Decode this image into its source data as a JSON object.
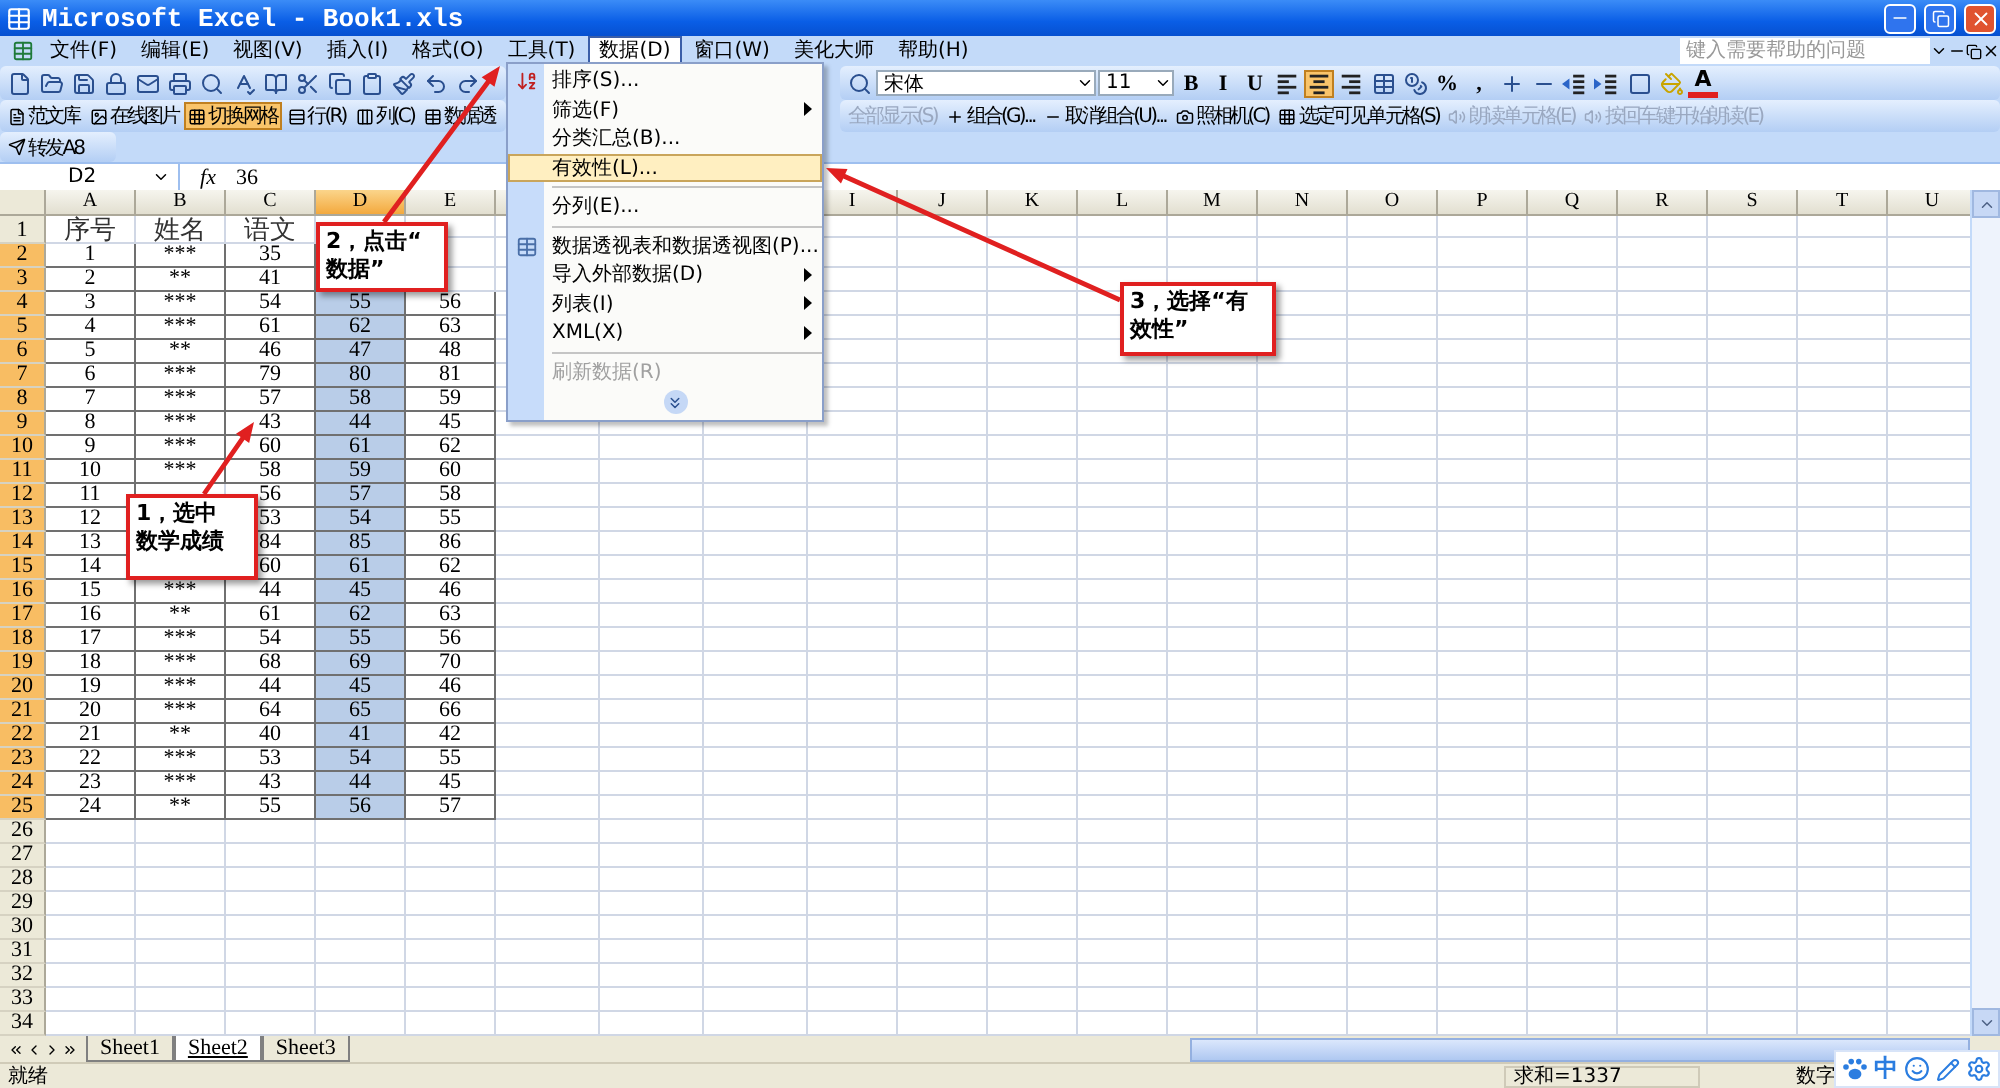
{
  "window": {
    "title": "Microsoft Excel - Book1.xls"
  },
  "menu_bar": {
    "items": [
      {
        "label": "文件(F)",
        "selected": false
      },
      {
        "label": "编辑(E)",
        "selected": false
      },
      {
        "label": "视图(V)",
        "selected": false
      },
      {
        "label": "插入(I)",
        "selected": false
      },
      {
        "label": "格式(O)",
        "selected": false
      },
      {
        "label": "工具(T)",
        "selected": false
      },
      {
        "label": "数据(D)",
        "selected": true
      },
      {
        "label": "窗口(W)",
        "selected": false
      },
      {
        "label": "美化大师",
        "selected": false
      },
      {
        "label": "帮助(H)",
        "selected": false
      }
    ],
    "help_field": {
      "placeholder": "键入需要帮助的问题"
    }
  },
  "formatting_toolbar": {
    "font": "宋体",
    "font_size": "11",
    "buttons": [
      {
        "kind": "text",
        "label": "B",
        "selected": false
      },
      {
        "kind": "text",
        "label": "I",
        "selected": false
      },
      {
        "kind": "text",
        "label": "U",
        "selected": false
      },
      {
        "kind": "align-left",
        "selected": false
      },
      {
        "kind": "align-center",
        "selected": true
      },
      {
        "kind": "align-right",
        "selected": false
      },
      {
        "kind": "merge",
        "selected": false
      },
      {
        "kind": "currency",
        "selected": false
      },
      {
        "kind": "text",
        "label": "%",
        "selected": false
      },
      {
        "kind": "text",
        "label": ",",
        "selected": false
      },
      {
        "kind": "decimal-more",
        "selected": false
      },
      {
        "kind": "decimal-less",
        "selected": false
      },
      {
        "kind": "indent-less",
        "selected": false
      },
      {
        "kind": "indent-more",
        "selected": false
      },
      {
        "kind": "borders",
        "selected": false
      },
      {
        "kind": "fill",
        "selected": false
      },
      {
        "kind": "font-color",
        "label": "A",
        "selected": false
      }
    ]
  },
  "tools_toolbar": {
    "left_items": [
      {
        "label": "范文库",
        "selected": false,
        "disabled": false
      },
      {
        "label": "在线图片",
        "selected": false,
        "disabled": false
      },
      {
        "label": "切换网格",
        "selected": true,
        "disabled": false
      },
      {
        "label": "行(R)",
        "selected": false,
        "disabled": false
      },
      {
        "label": "列(C)",
        "selected": false,
        "disabled": false
      },
      {
        "label": "数据透",
        "selected": false,
        "disabled": false
      }
    ],
    "right_items": [
      {
        "label": "全部显示(S)",
        "selected": false,
        "disabled": true
      },
      {
        "label": "组合(G)...",
        "selected": false,
        "disabled": false
      },
      {
        "label": "取消组合(U)...",
        "selected": false,
        "disabled": false
      },
      {
        "label": "照相机(C)",
        "selected": false,
        "disabled": false
      },
      {
        "label": "选定可见单元格(S)",
        "selected": false,
        "disabled": false
      },
      {
        "label": "朗读单元格(E)",
        "selected": false,
        "disabled": true
      },
      {
        "label": "按回车键开始朗读(E)",
        "selected": false,
        "disabled": true
      }
    ]
  },
  "forward_toolbar": {
    "label": "转发A8"
  },
  "formula_bar": {
    "name_box": "D2",
    "function_symbol": "fx",
    "value": "36"
  },
  "data_menu": {
    "items": [
      {
        "kind": "item",
        "label": "排序(S)...",
        "submenu": false,
        "selected": false,
        "disabled": false
      },
      {
        "kind": "item",
        "label": "筛选(F)",
        "submenu": true,
        "selected": false,
        "disabled": false
      },
      {
        "kind": "item",
        "label": "分类汇总(B)...",
        "submenu": false,
        "selected": false,
        "disabled": false
      },
      {
        "kind": "item",
        "label": "有效性(L)...",
        "submenu": false,
        "selected": true,
        "disabled": false
      },
      {
        "kind": "separator"
      },
      {
        "kind": "item",
        "label": "分列(E)...",
        "submenu": false,
        "selected": false,
        "disabled": false
      },
      {
        "kind": "separator"
      },
      {
        "kind": "item",
        "label": "数据透视表和数据透视图(P)...",
        "submenu": false,
        "selected": false,
        "disabled": false
      },
      {
        "kind": "item",
        "label": "导入外部数据(D)",
        "submenu": true,
        "selected": false,
        "disabled": false
      },
      {
        "kind": "item",
        "label": "列表(I)",
        "submenu": true,
        "selected": false,
        "disabled": false
      },
      {
        "kind": "item",
        "label": "XML(X)",
        "submenu": true,
        "selected": false,
        "disabled": false
      },
      {
        "kind": "separator"
      },
      {
        "kind": "item",
        "label": "刷新数据(R)",
        "submenu": false,
        "selected": false,
        "disabled": true
      },
      {
        "kind": "expand"
      }
    ]
  },
  "sheet": {
    "columns": [
      {
        "letter": "A",
        "selected": false
      },
      {
        "letter": "B",
        "selected": false
      },
      {
        "letter": "C",
        "selected": false
      },
      {
        "letter": "D",
        "selected": true
      },
      {
        "letter": "E",
        "selected": false
      },
      null,
      null,
      null,
      {
        "letter": "I",
        "selected": false
      },
      {
        "letter": "J",
        "selected": false
      },
      {
        "letter": "K",
        "selected": false
      },
      {
        "letter": "L",
        "selected": false
      },
      {
        "letter": "M",
        "selected": false
      },
      {
        "letter": "N",
        "selected": false
      },
      {
        "letter": "O",
        "selected": false
      },
      {
        "letter": "P",
        "selected": false
      },
      {
        "letter": "Q",
        "selected": false
      },
      {
        "letter": "R",
        "selected": false
      },
      {
        "letter": "S",
        "selected": false
      },
      {
        "letter": "T",
        "selected": false
      },
      {
        "letter": "U",
        "selected": false
      }
    ],
    "rows": [
      {
        "number": "1",
        "selected": false,
        "cells": [
          "序号",
          "姓名",
          "语文",
          null,
          null
        ]
      },
      {
        "number": "2",
        "selected": true,
        "cells": [
          "1",
          "***",
          "35",
          null,
          null
        ]
      },
      {
        "number": "3",
        "selected": true,
        "cells": [
          "2",
          "**",
          "41",
          null,
          null
        ]
      },
      {
        "number": "4",
        "selected": true,
        "cells": [
          "3",
          "***",
          "54",
          "55",
          "56"
        ]
      },
      {
        "number": "5",
        "selected": true,
        "cells": [
          "4",
          "***",
          "61",
          "62",
          "63"
        ]
      },
      {
        "number": "6",
        "selected": true,
        "cells": [
          "5",
          "**",
          "46",
          "47",
          "48"
        ]
      },
      {
        "number": "7",
        "selected": true,
        "cells": [
          "6",
          "***",
          "79",
          "80",
          "81"
        ]
      },
      {
        "number": "8",
        "selected": true,
        "cells": [
          "7",
          "***",
          "57",
          "58",
          "59"
        ]
      },
      {
        "number": "9",
        "selected": true,
        "cells": [
          "8",
          "***",
          "43",
          "44",
          "45"
        ]
      },
      {
        "number": "10",
        "selected": true,
        "cells": [
          "9",
          "***",
          "60",
          "61",
          "62"
        ]
      },
      {
        "number": "11",
        "selected": true,
        "cells": [
          "10",
          "***",
          "58",
          "59",
          "60"
        ]
      },
      {
        "number": "12",
        "selected": true,
        "cells": [
          "11",
          null,
          "56",
          "57",
          "58"
        ]
      },
      {
        "number": "13",
        "selected": true,
        "cells": [
          "12",
          null,
          "53",
          "54",
          "55"
        ]
      },
      {
        "number": "14",
        "selected": true,
        "cells": [
          "13",
          null,
          "84",
          "85",
          "86"
        ]
      },
      {
        "number": "15",
        "selected": true,
        "cells": [
          "14",
          null,
          "60",
          "61",
          "62"
        ]
      },
      {
        "number": "16",
        "selected": true,
        "cells": [
          "15",
          "***",
          "44",
          "45",
          "46"
        ]
      },
      {
        "number": "17",
        "selected": true,
        "cells": [
          "16",
          "**",
          "61",
          "62",
          "63"
        ]
      },
      {
        "number": "18",
        "selected": true,
        "cells": [
          "17",
          "***",
          "54",
          "55",
          "56"
        ]
      },
      {
        "number": "19",
        "selected": true,
        "cells": [
          "18",
          "***",
          "68",
          "69",
          "70"
        ]
      },
      {
        "number": "20",
        "selected": true,
        "cells": [
          "19",
          "***",
          "44",
          "45",
          "46"
        ]
      },
      {
        "number": "21",
        "selected": true,
        "cells": [
          "20",
          "***",
          "64",
          "65",
          "66"
        ]
      },
      {
        "number": "22",
        "selected": true,
        "cells": [
          "21",
          "**",
          "40",
          "41",
          "42"
        ]
      },
      {
        "number": "23",
        "selected": true,
        "cells": [
          "22",
          "***",
          "53",
          "54",
          "55"
        ]
      },
      {
        "number": "24",
        "selected": true,
        "cells": [
          "23",
          "***",
          "43",
          "44",
          "45"
        ]
      },
      {
        "number": "25",
        "selected": true,
        "cells": [
          "24",
          "**",
          "55",
          "56",
          "57"
        ]
      },
      {
        "number": "26",
        "selected": false
      },
      {
        "number": "27",
        "selected": false
      },
      {
        "number": "28",
        "selected": false
      },
      {
        "number": "29",
        "selected": false
      },
      {
        "number": "30",
        "selected": false
      },
      {
        "number": "31",
        "selected": false
      },
      {
        "number": "32",
        "selected": false
      },
      {
        "number": "33",
        "selected": false
      },
      {
        "number": "34",
        "selected": false
      }
    ]
  },
  "sheet_tabs": [
    {
      "label": "Sheet1",
      "selected": false
    },
    {
      "label": "Sheet2",
      "selected": true
    },
    {
      "label": "Sheet3",
      "selected": false
    }
  ],
  "status_bar": {
    "state": "就绪",
    "sum": "求和=1337",
    "mode": "数字"
  },
  "ime_bar": {
    "mode": "中"
  },
  "callouts": [
    {
      "lines": [
        "1，选中",
        "数学成绩"
      ]
    },
    {
      "lines": [
        "2，点击“",
        "数据”"
      ]
    },
    {
      "lines": [
        "3，选择“有",
        "效性”"
      ]
    }
  ]
}
